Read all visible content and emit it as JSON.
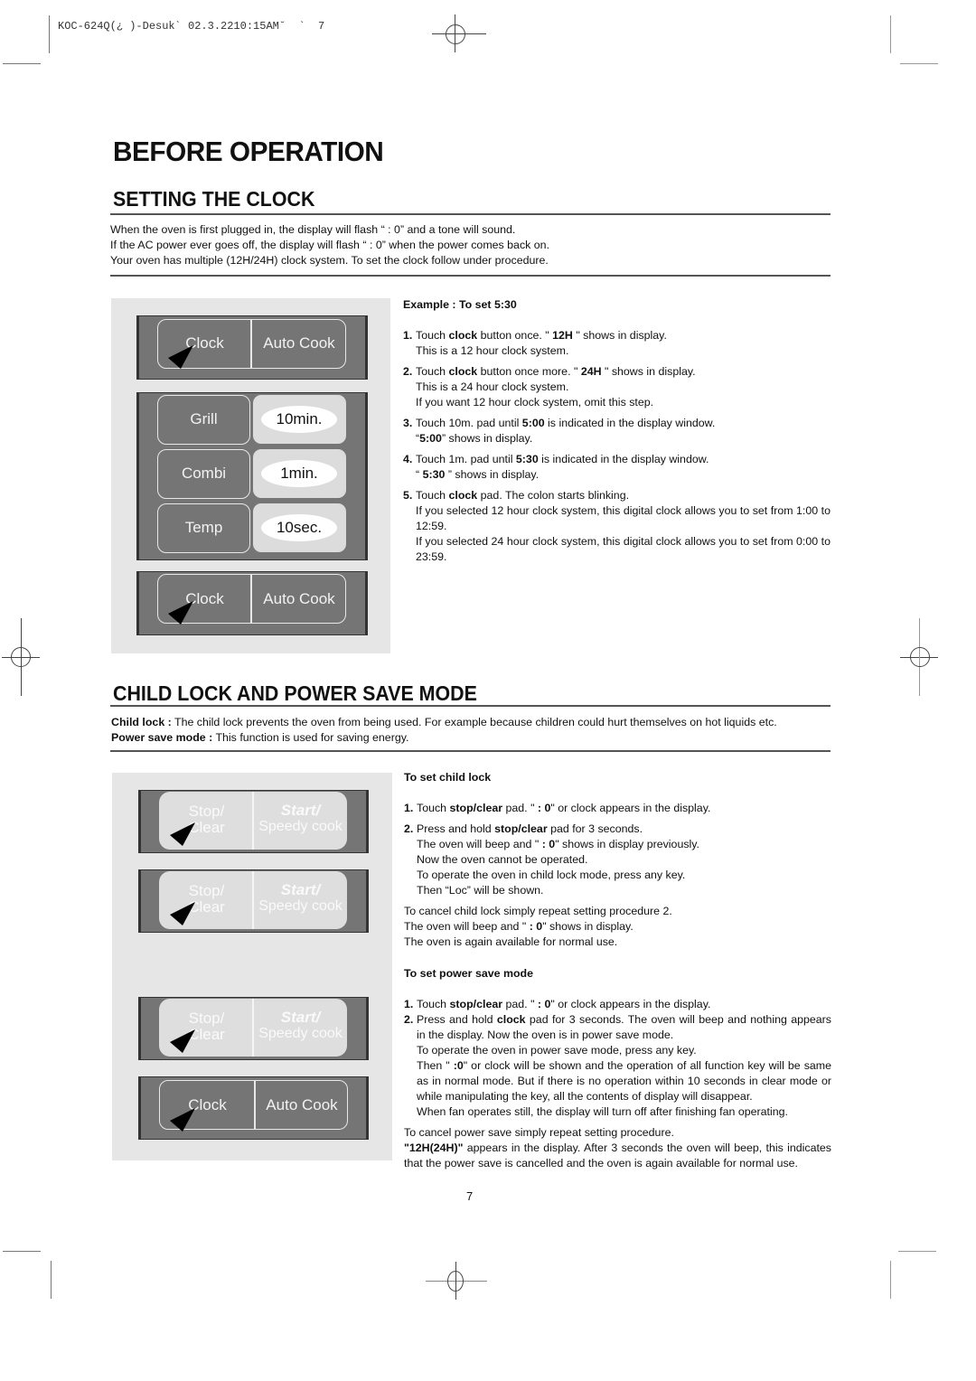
{
  "print_header": "KOC-624Q(¿ )-Desukˋ 02.3.2210:15AM˘  `  7",
  "page_title": "BEFORE OPERATION",
  "clock_section": {
    "title": "SETTING THE CLOCK",
    "intro": [
      "When the oven is first plugged in, the display will flash “ : 0” and a tone will sound.",
      "If the AC power ever goes off, the display will flash “ : 0” when the power comes back on.",
      "Your oven has multiple (12H/24H) clock system. To set the clock follow under procedure."
    ],
    "example_title": "Example : To set 5:30",
    "steps": [
      {
        "num": "1.",
        "pre": "Touch ",
        "b1": "clock",
        "mid": " button once. \" ",
        "b2": "12H",
        "post": " \" shows in display.",
        "extra": [
          "This is a 12 hour clock system."
        ]
      },
      {
        "num": "2.",
        "pre": "Touch ",
        "b1": "clock",
        "mid": " button once more. \" ",
        "b2": "24H",
        "post": " \" shows in display.",
        "extra": [
          "This is a 24 hour clock system.",
          "If you want 12 hour clock system, omit this step."
        ]
      },
      {
        "num": "3.",
        "pre": "Touch 10m. pad until ",
        "b1": "5:00",
        "mid": " is indicated in the display window.",
        "b2": "",
        "post": "",
        "extra_pre": "“",
        "extra_b": "5:00",
        "extra_post": "” shows in display."
      },
      {
        "num": "4.",
        "pre": "Touch 1m. pad until ",
        "b1": "5:30",
        "mid": " is indicated in the display window.",
        "b2": "",
        "post": "",
        "extra_pre": "“ ",
        "extra_b": "5:30",
        "extra_post": " ” shows in display."
      },
      {
        "num": "5.",
        "pre": "Touch ",
        "b1": "clock",
        "mid": " pad.  The colon starts blinking.",
        "b2": "",
        "post": "",
        "extra": [
          "If you selected 12 hour clock system, this digital clock allows you to set from 1:00 to 12:59.",
          "If you selected 24 hour clock system, this digital clock allows you to set from 0:00 to 23:59."
        ]
      }
    ],
    "keypad": {
      "clock": "Clock",
      "auto_cook": "Auto Cook",
      "grill": "Grill",
      "combi": "Combi",
      "temp": "Temp",
      "ten_min": "10min.",
      "one_min": "1min.",
      "ten_sec": "10sec."
    }
  },
  "childlock_section": {
    "title": "CHILD LOCK AND POWER SAVE MODE",
    "intro_childlock_label": "Child lock :",
    "intro_childlock_text": " The child lock prevents the oven from being used.  For example because children could hurt themselves on hot liquids etc.",
    "intro_powersave_label": "Power save mode :",
    "intro_powersave_text": " This function is used for saving energy.",
    "childlock_title": "To set child lock",
    "childlock_step1": {
      "num": "1.",
      "pre": "Touch ",
      "b1": "stop/clear",
      "mid": " pad.  \" ",
      "b2": ": 0",
      "post": "\" or clock appears in the display."
    },
    "childlock_step2": {
      "num": "2.",
      "pre": "Press and hold ",
      "b1": "stop/clear",
      "post": " pad for 3 seconds.",
      "l2_pre": "The oven will beep and  \" ",
      "l2_b": ": 0",
      "l2_post": "\" shows in display previously.",
      "extra": [
        "Now the oven cannot be operated.",
        "To operate the oven in child lock mode, press any key.",
        "Then “Loc” will be shown."
      ]
    },
    "childlock_cancel": [
      "To cancel child lock simply repeat setting procedure 2."
    ],
    "childlock_cancel2_pre": "The oven will beep and \" ",
    "childlock_cancel2_b": ": 0",
    "childlock_cancel2_post": "\" shows in display.",
    "childlock_cancel3": "The oven is again available for normal use.",
    "powersave_title": "To set power save mode",
    "powersave_step1": {
      "num": "1.",
      "pre": "Touch ",
      "b1": "stop/clear",
      "mid": " pad.  \" ",
      "b2": ": 0",
      "post": "\" or clock appears in the display."
    },
    "powersave_step2": {
      "num": "2.",
      "pre": "Press and hold ",
      "b1": "clock",
      "post": " pad for 3 seconds. The oven will beep and nothing appears in the display.  Now the oven is in power save mode.",
      "l2": "To operate the oven in power save mode, press any key.",
      "l3_pre": "Then \" ",
      "l3_b": ":0",
      "l3_post": "\" or clock will be shown and the operation of all function key will be same as in normal mode. But if there is no operation within 10 seconds in clear mode or while manipulating the key, all the contents of display will disappear.",
      "l4": "When fan operates still, the display will turn off after finishing fan operating."
    },
    "powersave_cancel1": "To cancel power save simply repeat setting procedure.",
    "powersave_cancel2_b": "\"12H(24H)\"",
    "powersave_cancel2_post": " appears in the display.  After 3 seconds the oven will beep, this indicates that the power save is cancelled and the oven is again available for normal use.",
    "keypad": {
      "stop": "Stop/",
      "clear": "Clear",
      "start": "Start/",
      "speedy": "Speedy cook",
      "clock": "Clock",
      "auto_cook": "Auto Cook"
    }
  },
  "page_number": "7"
}
